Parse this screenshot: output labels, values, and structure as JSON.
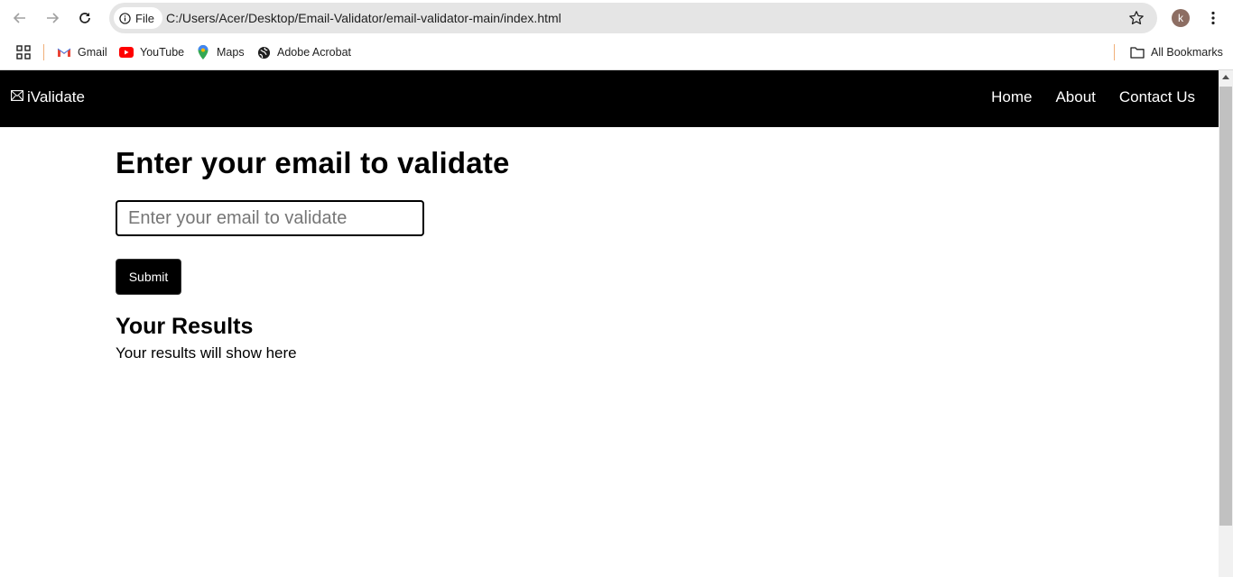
{
  "browser": {
    "site_chip_label": "File",
    "url": "C:/Users/Acer/Desktop/Email-Validator/email-validator-main/index.html",
    "profile_initial": "k",
    "icons": [
      "back-icon",
      "forward-icon",
      "reload-icon",
      "info-icon",
      "star-icon",
      "more-icon"
    ]
  },
  "bookmarks": {
    "items": [
      {
        "label": "Gmail",
        "icon": "gmail-icon"
      },
      {
        "label": "YouTube",
        "icon": "youtube-icon"
      },
      {
        "label": "Maps",
        "icon": "maps-icon"
      },
      {
        "label": "Adobe Acrobat",
        "icon": "globe-icon"
      }
    ],
    "all_bookmarks": "All Bookmarks"
  },
  "site": {
    "brand": "iValidate",
    "nav": [
      "Home",
      "About",
      "Contact Us"
    ],
    "heading": "Enter your email to validate",
    "input_placeholder": "Enter your email to validate",
    "submit_label": "Submit",
    "results_title": "Your Results",
    "results_text": "Your results will show here",
    "colors": {
      "nav_bg": "#000000",
      "button_bg": "#000000",
      "text": "#000000"
    }
  }
}
